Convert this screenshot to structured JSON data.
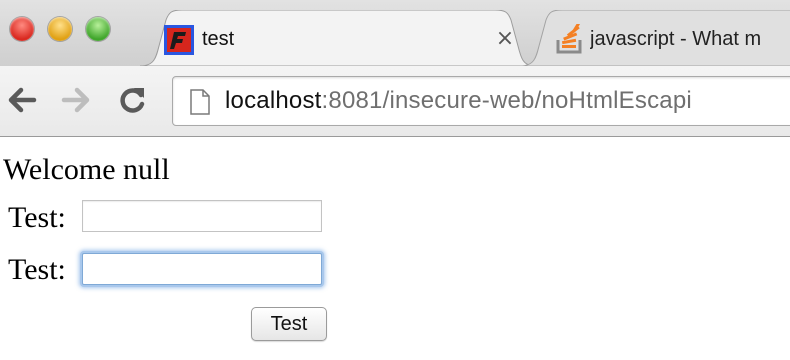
{
  "window": {
    "tabs": [
      {
        "title": "test",
        "favicon": "red-square-favicon",
        "active": true,
        "close_glyph": "×"
      },
      {
        "title": "javascript - What m",
        "favicon": "stack-overflow-favicon",
        "active": false
      }
    ]
  },
  "toolbar": {
    "back_icon": "back-arrow-icon",
    "forward_icon": "forward-arrow-icon",
    "reload_icon": "reload-icon",
    "page_icon": "page-icon",
    "url_host": "localhost",
    "url_rest": ":8081/insecure-web/noHtmlEscapi"
  },
  "page": {
    "welcome_text": "Welcome null",
    "form": {
      "field1_label": "Test:",
      "field1_value": "",
      "field2_label": "Test:",
      "field2_value": "",
      "submit_label": "Test"
    }
  },
  "colors": {
    "focus_ring": "#a9c8ec",
    "url_host": "#111111",
    "url_rest": "#6f6f6f"
  }
}
